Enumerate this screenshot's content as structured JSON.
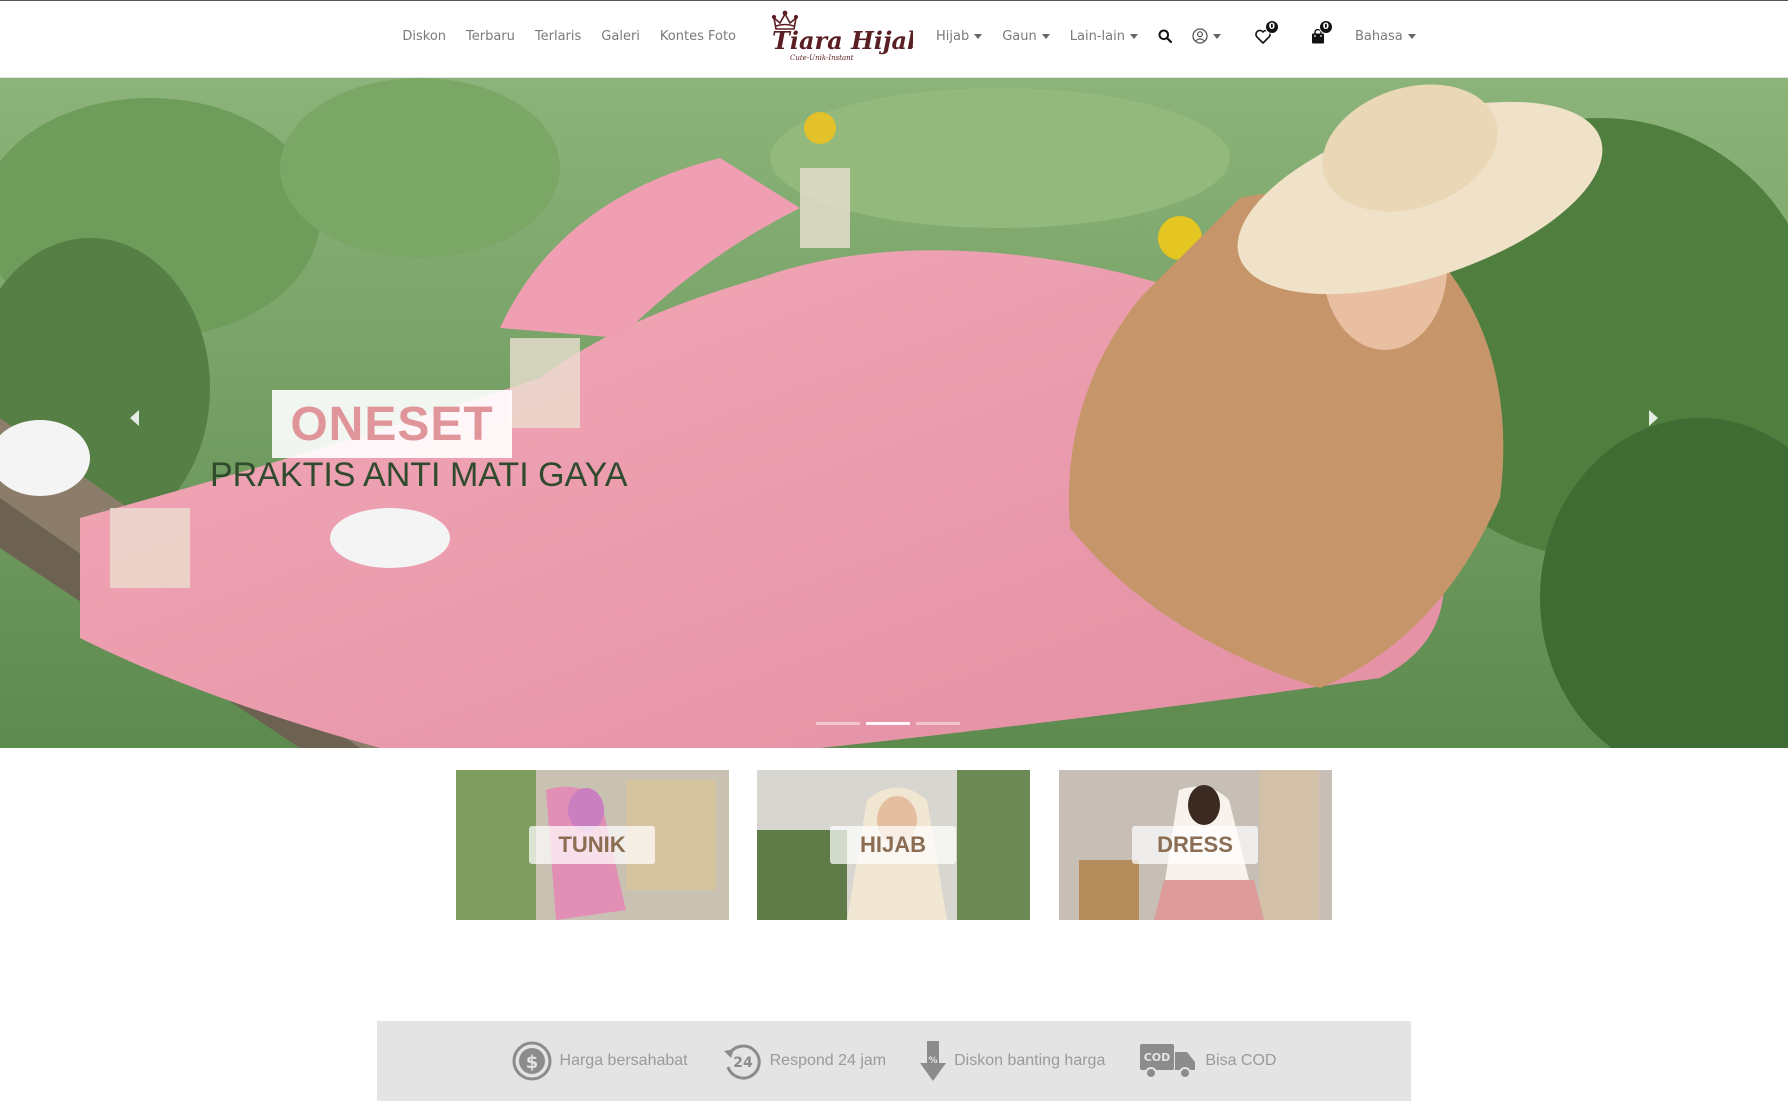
{
  "nav": {
    "left_links": [
      {
        "label": "Diskon"
      },
      {
        "label": "Terbaru"
      },
      {
        "label": "Terlaris"
      },
      {
        "label": "Galeri"
      },
      {
        "label": "Kontes Foto"
      }
    ],
    "logo": {
      "brand": "Tiara Hijabers",
      "tagline": "Cute-Unik-Instant"
    },
    "right_links": [
      {
        "label": "Hijab"
      },
      {
        "label": "Gaun"
      },
      {
        "label": "Lain-lain"
      }
    ],
    "icons": {
      "search": "search-icon",
      "account": "user-icon",
      "wishlist": "heart-icon",
      "cart": "shopping-bag-icon"
    },
    "wishlist_count": "0",
    "cart_count": "0",
    "language_label": "Bahasa"
  },
  "hero": {
    "title": "ONESET",
    "subtitle": "PRAKTIS ANTI MATI GAYA",
    "slide_count": 3,
    "active_slide": 2,
    "title_color": "#e0959a",
    "subtitle_color": "#2f4a2c"
  },
  "categories": [
    {
      "label": "TUNIK"
    },
    {
      "label": "HIJAB"
    },
    {
      "label": "DRESS"
    }
  ],
  "features": [
    {
      "icon": "dollar-icon",
      "label": "Harga bersahabat"
    },
    {
      "icon": "clock-24-icon",
      "label": "Respond 24 jam"
    },
    {
      "icon": "discount-arrow-icon",
      "label": "Diskon banting harga"
    },
    {
      "icon": "cod-truck-icon",
      "label": "Bisa COD",
      "icon_text": "COD"
    }
  ],
  "colors": {
    "accent": "#111111",
    "label_text": "#8a6d52",
    "feature_text": "#9a9a9a",
    "feature_bg": "#e4e4e4"
  }
}
